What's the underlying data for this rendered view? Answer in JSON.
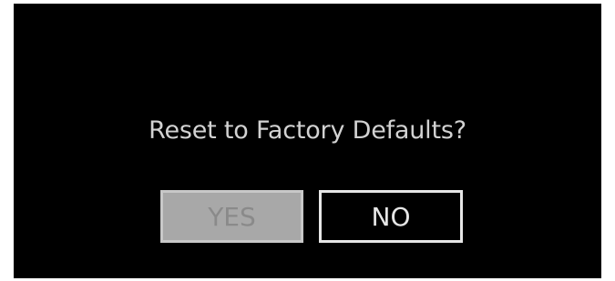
{
  "dialog": {
    "prompt": "Reset to Factory Defaults?",
    "yes_label": "YES",
    "no_label": "NO",
    "selected_option": "YES"
  },
  "colors": {
    "background": "#000000",
    "text": "#d2d2d2",
    "selected_fill": "#a8a8a8",
    "selected_text": "#8a8a8a",
    "unselected_border": "#e6e6e6"
  }
}
